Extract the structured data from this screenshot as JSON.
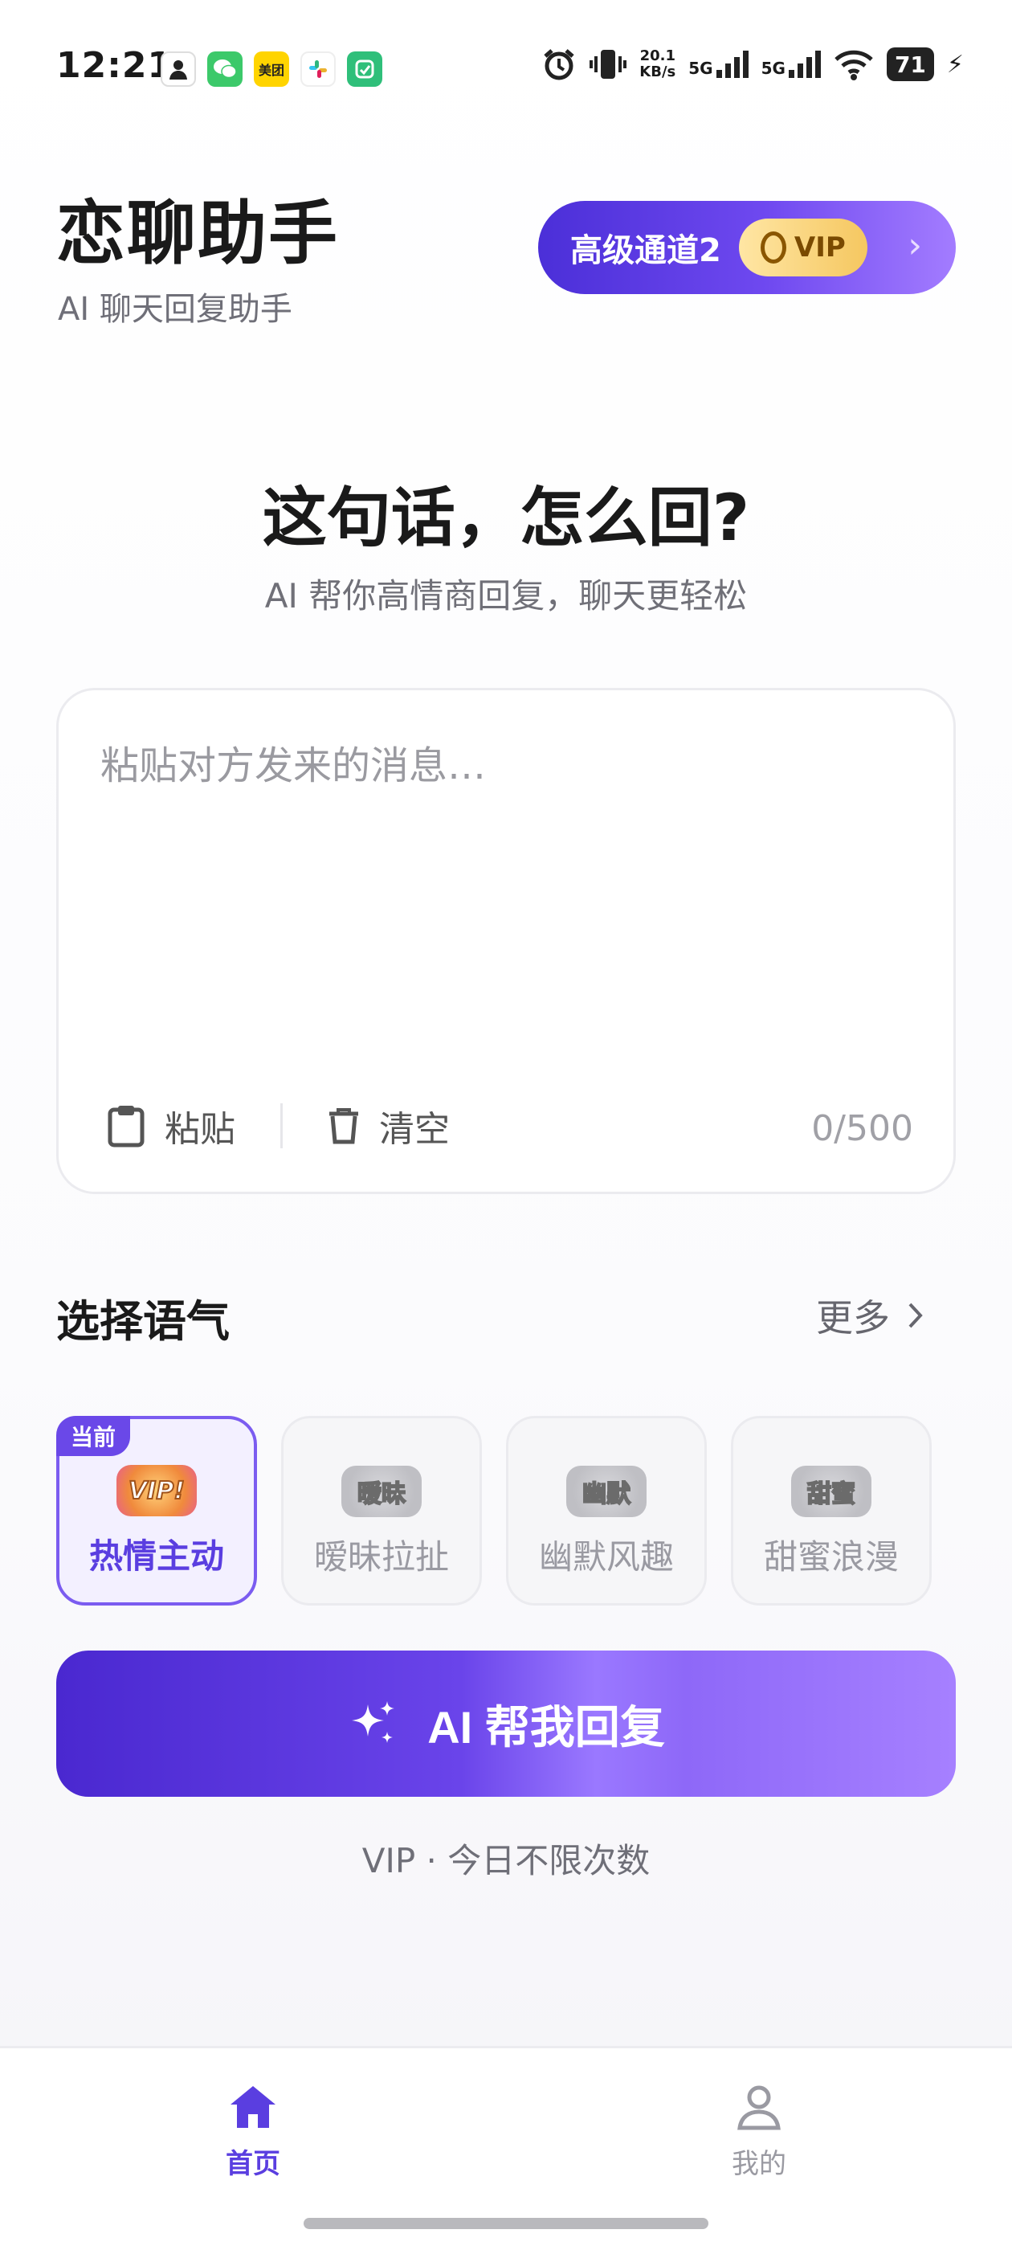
{
  "status_bar": {
    "time": "12:21",
    "net_speed": "20.1",
    "net_unit": "KB/s",
    "sig1": "5G",
    "sig2": "5G",
    "battery": "71",
    "app_icons": [
      {
        "name": "profile-app-icon",
        "color": "#ffffff"
      },
      {
        "name": "wechat-icon",
        "color": "#3cc96a"
      },
      {
        "name": "meituan-icon",
        "color": "#ffd400",
        "label": "美团"
      },
      {
        "name": "slack-icon",
        "color": "#ffffff"
      },
      {
        "name": "green-app-icon",
        "color": "#2fbf7a"
      }
    ]
  },
  "header": {
    "title": "恋聊助手",
    "subtitle": "AI 聊天回复助手",
    "vip_pill_label": "高级通道2",
    "vip_badge": "VIP"
  },
  "hero": {
    "title": "这句话，怎么回?",
    "subtitle": "AI 帮你高情商回复，聊天更轻松"
  },
  "input_card": {
    "placeholder": "粘贴对方发来的消息…",
    "paste_label": "粘贴",
    "clear_label": "清空",
    "counter": "0/500"
  },
  "tone_section": {
    "title": "选择语气",
    "more_label": "更多",
    "current_badge": "当前",
    "tones": [
      {
        "label": "热情主动",
        "sticker": "VIP!",
        "active": true
      },
      {
        "label": "暧昧拉扯",
        "sticker": "暧昧",
        "active": false
      },
      {
        "label": "幽默风趣",
        "sticker": "幽默",
        "active": false
      },
      {
        "label": "甜蜜浪漫",
        "sticker": "甜蜜",
        "active": false
      }
    ]
  },
  "cta": {
    "label": "AI 帮我回复",
    "quota": "VIP · 今日不限次数"
  },
  "bottom_nav": {
    "home_label": "首页",
    "me_label": "我的"
  },
  "colors": {
    "accent": "#6a48e8",
    "accent_dark": "#4a28d0",
    "gold": "#f5c760"
  }
}
